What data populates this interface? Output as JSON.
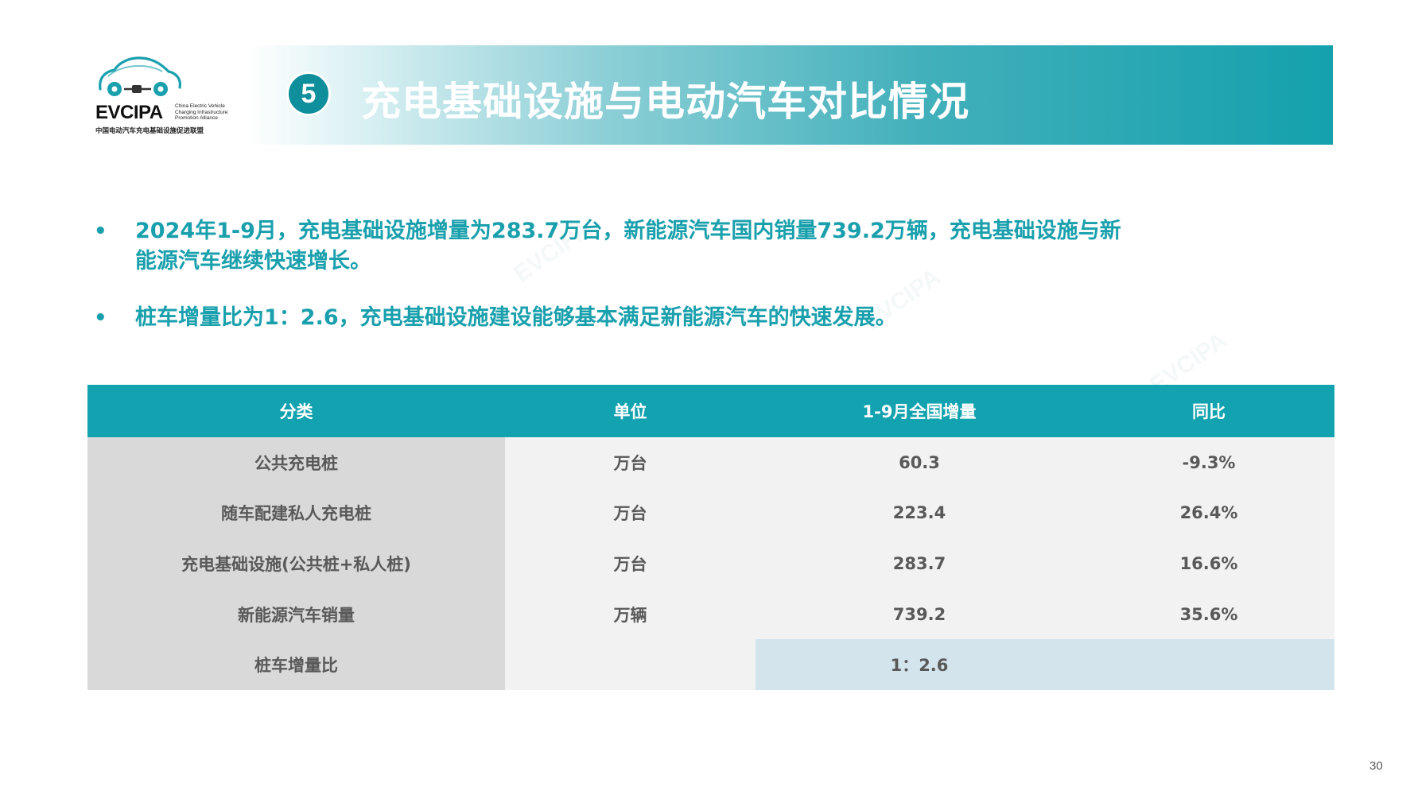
{
  "logo": {
    "brand": "EVCIPA",
    "brand_en": "China Electric Vehicle Charging Infrastructure Promotion Alliance",
    "brand_cn": "中国电动汽车充电基础设施促进联盟"
  },
  "header": {
    "number": "5",
    "title": "充电基础设施与电动汽车对比情况"
  },
  "bullets": [
    {
      "line1": "2024年1-9月，充电基础设施增量为283.7万台，新能源汽车国内销量739.2万辆，充电基础设施与新",
      "line2": "能源汽车继续快速增长。"
    },
    {
      "line1": "桩车增量比为1：2.6，充电基础设施建设能够基本满足新能源汽车的快速发展。"
    }
  ],
  "bullet_symbol": "•",
  "table": {
    "headers": [
      "分类",
      "单位",
      "1-9月全国增量",
      "同比"
    ],
    "rows": [
      [
        "公共充电桩",
        "万台",
        "60.3",
        "-9.3%"
      ],
      [
        "随车配建私人充电桩",
        "万台",
        "223.4",
        "26.4%"
      ],
      [
        "充电基础设施(公共桩+私人桩)",
        "万台",
        "283.7",
        "16.6%"
      ],
      [
        "新能源汽车销量",
        "万辆",
        "739.2",
        "35.6%"
      ]
    ],
    "ratio_row": {
      "label": "桩车增量比",
      "unit": "",
      "value": "1：2.6"
    }
  },
  "page_number": "30",
  "colors": {
    "accent": "#13a2af",
    "bullet_text": "#1aa0ad",
    "label_col": "#d9d9d9",
    "cell_bg": "#f2f2f2",
    "ratio_bg": "#d3e4ec"
  }
}
